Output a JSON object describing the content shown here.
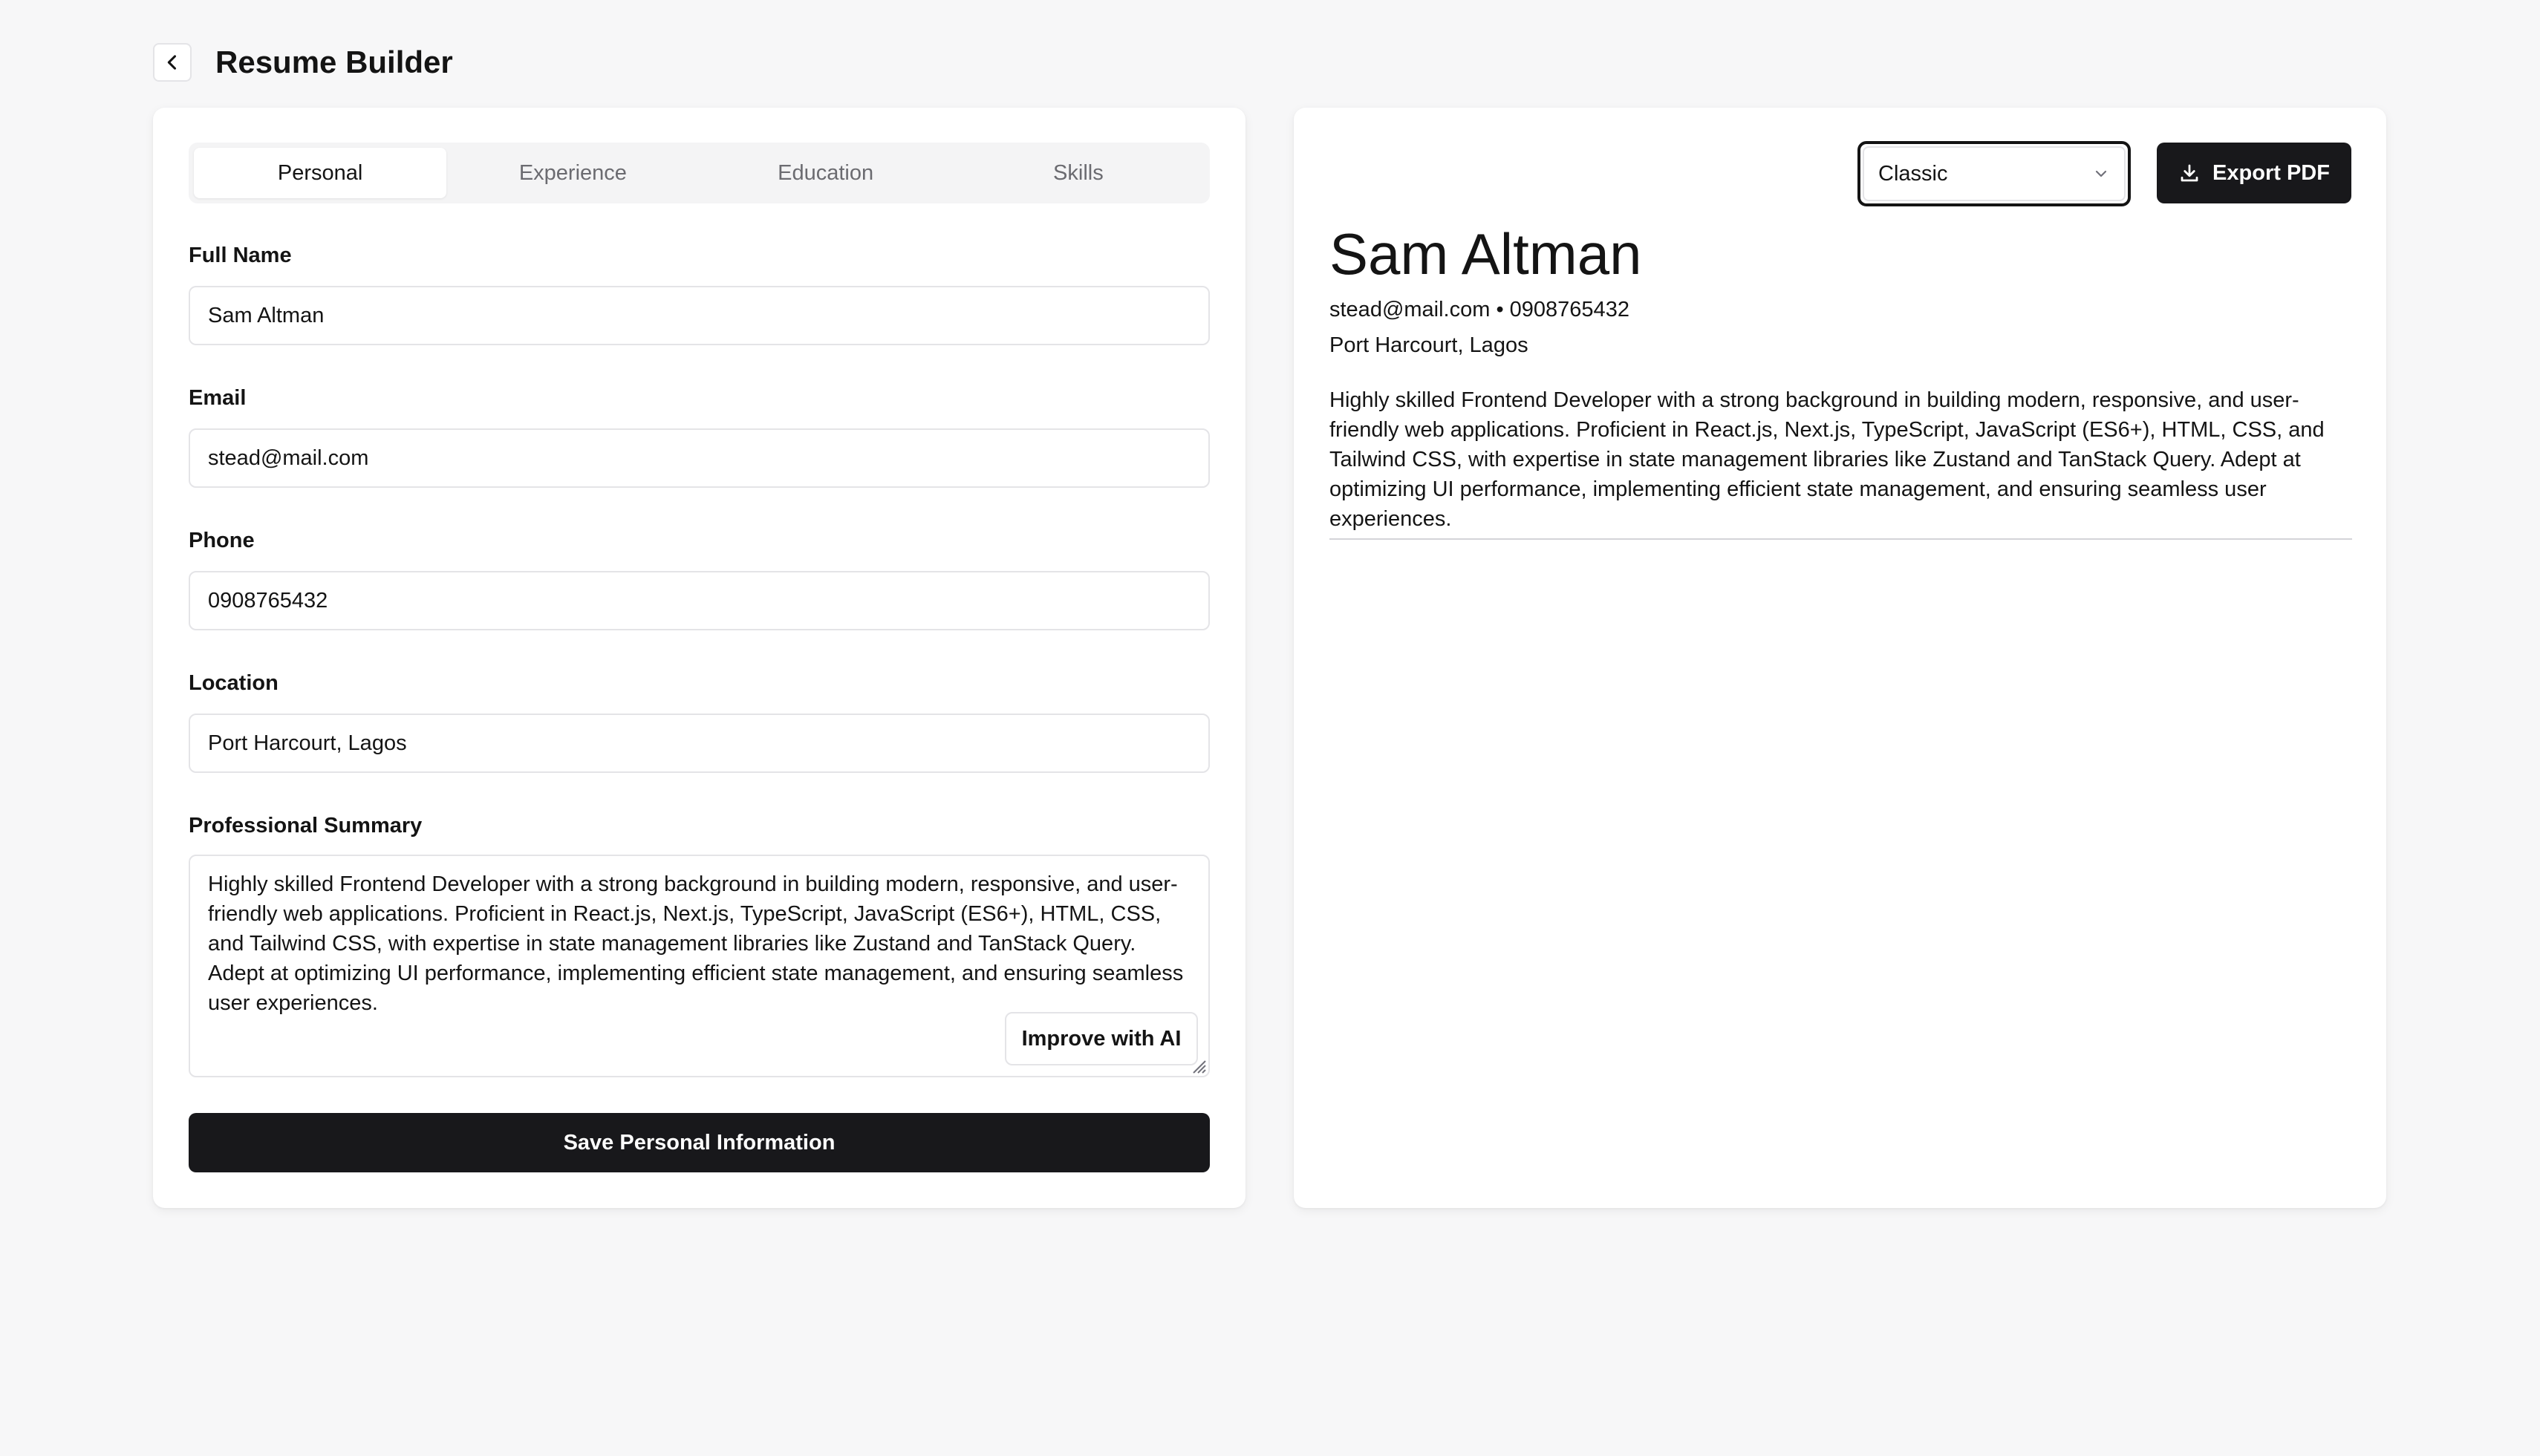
{
  "header": {
    "title": "Resume Builder"
  },
  "form": {
    "tabs": [
      {
        "label": "Personal",
        "active": true
      },
      {
        "label": "Experience",
        "active": false
      },
      {
        "label": "Education",
        "active": false
      },
      {
        "label": "Skills",
        "active": false
      }
    ],
    "full_name": {
      "label": "Full Name",
      "value": "Sam Altman"
    },
    "email": {
      "label": "Email",
      "value": "stead@mail.com"
    },
    "phone": {
      "label": "Phone",
      "value": "0908765432"
    },
    "location": {
      "label": "Location",
      "value": "Port Harcourt, Lagos"
    },
    "summary": {
      "label": "Professional Summary",
      "value": "Highly skilled Frontend Developer with a strong background in building modern, responsive, and user-friendly web applications. Proficient in React.js, Next.js, TypeScript, JavaScript (ES6+), HTML, CSS, and Tailwind CSS, with expertise in state management libraries like Zustand and TanStack Query. Adept at optimizing UI performance, implementing efficient state management, and ensuring seamless user experiences."
    },
    "improve_ai_label": "Improve with AI",
    "save_label": "Save Personal Information"
  },
  "preview": {
    "template_select": {
      "value": "Classic"
    },
    "export_label": "Export PDF",
    "name": "Sam Altman",
    "contact": "stead@mail.com • 0908765432",
    "location": "Port Harcourt, Lagos",
    "summary": "Highly skilled Frontend Developer with a strong background in building modern, responsive, and user-friendly web applications. Proficient in React.js, Next.js, TypeScript, JavaScript (ES6+), HTML, CSS, and Tailwind CSS, with expertise in state management libraries like Zustand and TanStack Query. Adept at optimizing UI performance, implementing efficient state management, and ensuring seamless user experiences."
  },
  "icons": {
    "back": "chevron-left-icon",
    "select": "chevron-down-icon",
    "export": "download-icon",
    "resize": "resize-handle-icon"
  },
  "colors": {
    "background": "#f7f7f8",
    "primary_button": "#18181b",
    "border": "#e4e4e7",
    "text": "#141414",
    "muted_text": "#6b6b70"
  }
}
